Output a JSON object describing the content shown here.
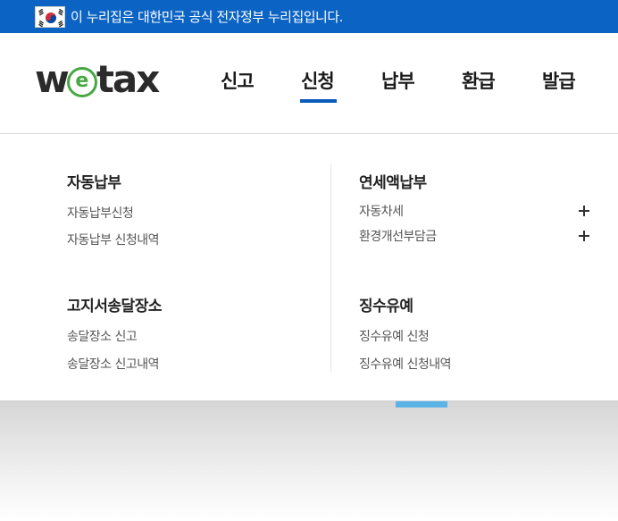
{
  "gov_banner": {
    "text": "이 누리집은 대한민국 공식 전자정부 누리집입니다."
  },
  "logo": {
    "w": "w",
    "e": "e",
    "tax": "tax",
    "brand_green": "#47a842"
  },
  "nav": {
    "items": [
      {
        "label": "신고",
        "active": false
      },
      {
        "label": "신청",
        "active": true
      },
      {
        "label": "납부",
        "active": false
      },
      {
        "label": "환급",
        "active": false
      },
      {
        "label": "발급",
        "active": false
      }
    ],
    "accent": "#0b5cb8"
  },
  "dropdown": {
    "sections": [
      {
        "title": "자동납부",
        "links": [
          "자동납부신청",
          "자동납부 신청내역"
        ]
      },
      {
        "title": "연세액납부",
        "links": [
          "자동차세",
          "환경개선부담금"
        ],
        "expandable": true
      },
      {
        "title": "고지서송달장소",
        "links": [
          "송달장소 신고",
          "송달장소 신고내역"
        ]
      },
      {
        "title": "징수유예",
        "links": [
          "징수유예 신청",
          "징수유예 신청내역"
        ]
      }
    ]
  },
  "colors": {
    "banner_bg": "#0b63c4",
    "tab_highlight": "#5bb3e6"
  }
}
